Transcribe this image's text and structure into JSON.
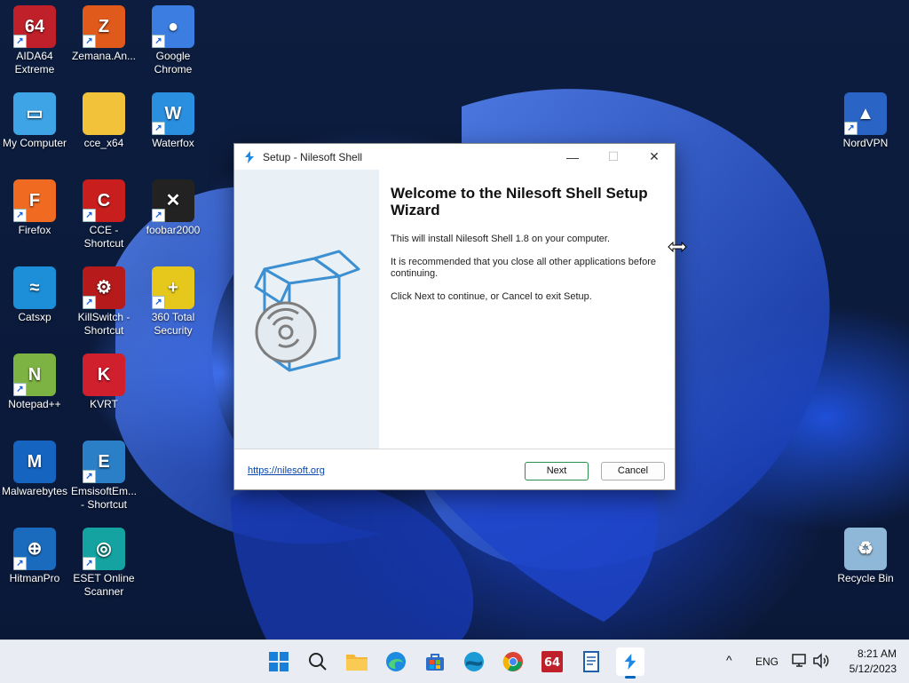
{
  "desktop": {
    "icons": [
      {
        "label": "AIDA64\nExtreme",
        "glyph": "64",
        "color": "#c0202a",
        "shortcut": true
      },
      {
        "label": "Zemana.An...",
        "glyph": "Z",
        "color": "#e05a1c",
        "shortcut": true
      },
      {
        "label": "Google\nChrome",
        "glyph": "●",
        "color": "#3b7de0",
        "shortcut": true
      },
      {
        "label": "My Computer",
        "glyph": "▭",
        "color": "#3fa4e6",
        "shortcut": false
      },
      {
        "label": "cce_x64",
        "glyph": "",
        "color": "#f2c23a",
        "shortcut": false
      },
      {
        "label": "Waterfox",
        "glyph": "W",
        "color": "#2b8fe0",
        "shortcut": true
      },
      {
        "label": "Firefox",
        "glyph": "F",
        "color": "#f06b21",
        "shortcut": true
      },
      {
        "label": "CCE -\nShortcut",
        "glyph": "C",
        "color": "#c81e1e",
        "shortcut": true
      },
      {
        "label": "foobar2000",
        "glyph": "✕",
        "color": "#222222",
        "shortcut": true
      },
      {
        "label": "Catsxp",
        "glyph": "≈",
        "color": "#1c8fd8",
        "shortcut": false
      },
      {
        "label": "KillSwitch -\nShortcut",
        "glyph": "⚙",
        "color": "#b61a1a",
        "shortcut": true
      },
      {
        "label": "360 Total\nSecurity",
        "glyph": "+",
        "color": "#e5c81b",
        "shortcut": true
      },
      {
        "label": "Notepad++",
        "glyph": "N",
        "color": "#7cb342",
        "shortcut": true
      },
      {
        "label": "KVRT",
        "glyph": "K",
        "color": "#d01f2d",
        "shortcut": false
      },
      {
        "label": "Malwarebytes",
        "glyph": "M",
        "color": "#1565c0",
        "shortcut": false
      },
      {
        "label": "EmsisoftEm...\n- Shortcut",
        "glyph": "E",
        "color": "#2a7fc7",
        "shortcut": true
      },
      {
        "label": "HitmanPro",
        "glyph": "⊕",
        "color": "#1a6bbd",
        "shortcut": true
      },
      {
        "label": "ESET Online\nScanner",
        "glyph": "◎",
        "color": "#14a3a0",
        "shortcut": true
      },
      {
        "label": "NordVPN",
        "glyph": "▲",
        "color": "#2a64c5",
        "shortcut": true
      },
      {
        "label": "Recycle Bin",
        "glyph": "♻",
        "color": "#8fb8d8",
        "shortcut": false
      }
    ]
  },
  "dialog": {
    "title": "Setup - Nilesoft Shell",
    "heading": "Welcome to the Nilesoft Shell Setup Wizard",
    "para1": "This will install Nilesoft Shell 1.8 on your computer.",
    "para2": "It is recommended that you close all other applications before continuing.",
    "para3": "Click Next to continue, or Cancel to exit Setup.",
    "link": "https://nilesoft.org",
    "next_label": "Next",
    "cancel_label": "Cancel",
    "minimize": "—",
    "maximize": "☐",
    "close": "✕"
  },
  "taskbar": {
    "apps": [
      "start",
      "search",
      "file-explorer",
      "edge",
      "store",
      "catsxp",
      "chrome",
      "aida64",
      "notepad",
      "nilesoft-setup"
    ],
    "tray_chevron": "^",
    "language": "ENG",
    "time": "8:21 AM",
    "date": "5/12/2023"
  }
}
